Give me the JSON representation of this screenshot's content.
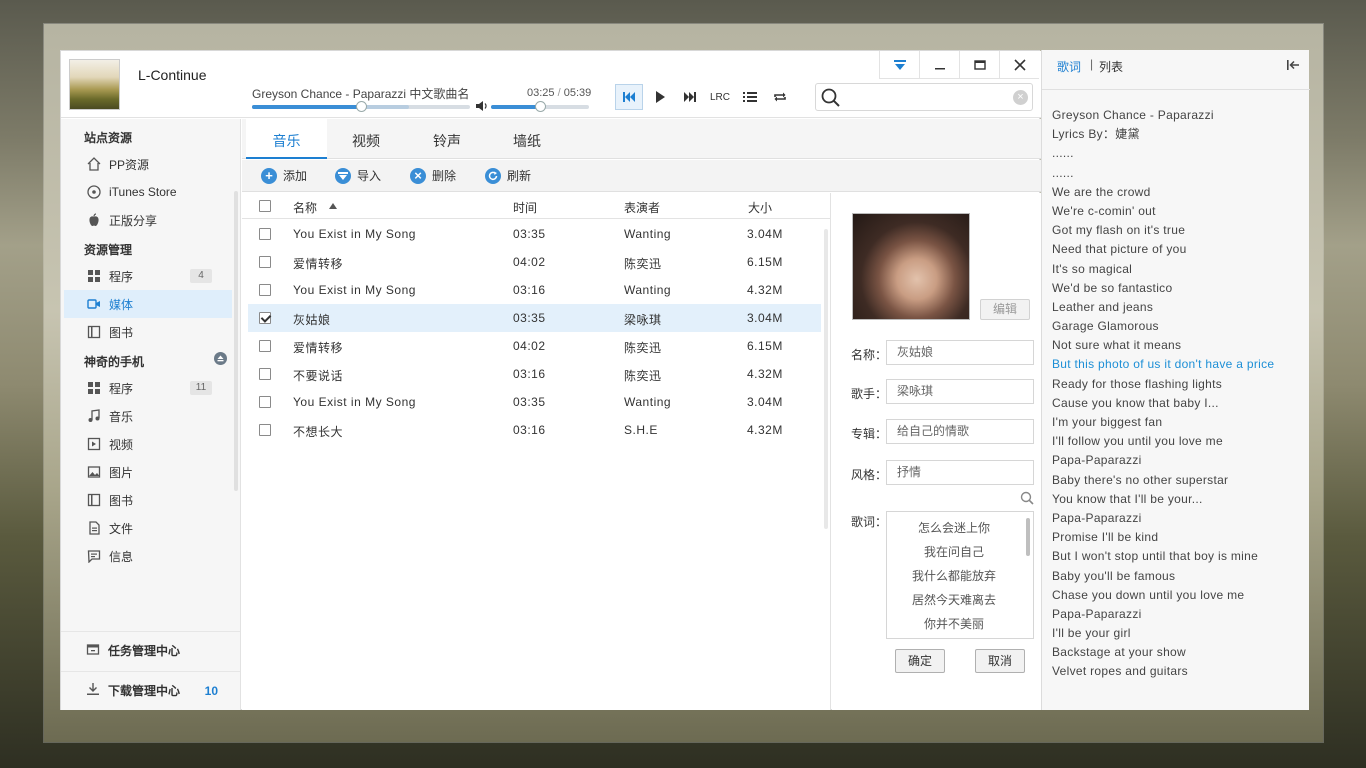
{
  "header": {
    "username": "L-Continue",
    "now_playing": "Greyson Chance - Paparazzi 中文歌曲名",
    "time_current": "03:25",
    "time_sep": "/",
    "time_total": "05:39",
    "progress": 0.5,
    "buffered": 0.72,
    "volume": 0.5,
    "lrc_label": "LRC",
    "search_placeholder": ""
  },
  "sidebar": {
    "sections": [
      {
        "title": "站点资源",
        "items": [
          {
            "label": "PP资源",
            "icon": "home-icon"
          },
          {
            "label": "iTunes Store",
            "icon": "music-disc-icon"
          },
          {
            "label": "正版分享",
            "icon": "apple-icon"
          }
        ]
      },
      {
        "title": "资源管理",
        "items": [
          {
            "label": "程序",
            "icon": "grid-icon",
            "badge": "4"
          },
          {
            "label": "媒体",
            "icon": "video-icon",
            "active": true
          },
          {
            "label": "图书",
            "icon": "book-icon"
          }
        ]
      },
      {
        "title": "神奇的手机",
        "items": [
          {
            "label": "程序",
            "icon": "grid-icon",
            "badge": "11"
          },
          {
            "label": "音乐",
            "icon": "music-note-icon"
          },
          {
            "label": "视频",
            "icon": "film-icon"
          },
          {
            "label": "图片",
            "icon": "picture-icon"
          },
          {
            "label": "图书",
            "icon": "book-icon"
          },
          {
            "label": "文件",
            "icon": "file-icon"
          },
          {
            "label": "信息",
            "icon": "message-icon"
          }
        ]
      }
    ],
    "task_center": "任务管理中心",
    "download_center": "下载管理中心",
    "download_count": "10"
  },
  "tabs": [
    "音乐",
    "视频",
    "铃声",
    "墙纸"
  ],
  "toolbar": {
    "add": "添加",
    "import": "导入",
    "delete": "删除",
    "refresh": "刷新"
  },
  "table": {
    "columns": {
      "name": "名称",
      "time": "时间",
      "artist": "表演者",
      "size": "大小"
    },
    "rows": [
      {
        "name": "You Exist in My Song",
        "time": "03:35",
        "artist": "Wanting",
        "size": "3.04M",
        "checked": false
      },
      {
        "name": "爱情转移",
        "time": "04:02",
        "artist": "陈奕迅",
        "size": "6.15M",
        "checked": false
      },
      {
        "name": "You Exist in My Song",
        "time": "03:16",
        "artist": "Wanting",
        "size": "4.32M",
        "checked": false
      },
      {
        "name": "灰姑娘",
        "time": "03:35",
        "artist": "梁咏琪",
        "size": "3.04M",
        "checked": true
      },
      {
        "name": "爱情转移",
        "time": "04:02",
        "artist": "陈奕迅",
        "size": "6.15M",
        "checked": false
      },
      {
        "name": "不要说话",
        "time": "03:16",
        "artist": "陈奕迅",
        "size": "4.32M",
        "checked": false
      },
      {
        "name": "You Exist in My Song",
        "time": "03:35",
        "artist": "Wanting",
        "size": "3.04M",
        "checked": false
      },
      {
        "name": "不想长大",
        "time": "03:16",
        "artist": "S.H.E",
        "size": "4.32M",
        "checked": false
      }
    ]
  },
  "detail": {
    "edit": "编辑",
    "name_label": "名称：",
    "name_value": "灰姑娘",
    "singer_label": "歌手：",
    "singer_value": "梁咏琪",
    "album_label": "专辑：",
    "album_value": "给自己的情歌",
    "style_label": "风格：",
    "style_value": "抒情",
    "lyrics_label": "歌词：",
    "lyrics": [
      "怎么会迷上你",
      "我在问自己",
      "我什么都能放弃",
      "居然今天难离去",
      "你并不美丽"
    ],
    "ok": "确定",
    "cancel": "取消"
  },
  "panel": {
    "tab_lyrics": "歌词",
    "sep": "|",
    "tab_list": "列表",
    "current_index": 13,
    "lines": [
      "Greyson Chance - Paparazzi",
      "Lyrics By：婕黛",
      "......",
      "......",
      "We are the crowd",
      "We're c-comin' out",
      "Got my flash on it's true",
      "Need that picture of you",
      "It's so magical",
      "We'd be so fantastico",
      "Leather and jeans",
      "Garage Glamorous",
      "Not sure what it means",
      "But this photo of us it don't have a price",
      "Ready for those flashing lights",
      "Cause you know that baby I...",
      "I'm your biggest fan",
      "I'll follow you until you love me",
      "Papa-Paparazzi",
      "Baby there's no other superstar",
      "You know that I'll be your...",
      "Papa-Paparazzi",
      "Promise I'll be kind",
      "But I won't stop until that boy is mine",
      "Baby you'll be famous",
      "Chase you down until you love me",
      "Papa-Paparazzi",
      "I'll be your girl",
      "Backstage at your show",
      "Velvet ropes and guitars"
    ]
  }
}
